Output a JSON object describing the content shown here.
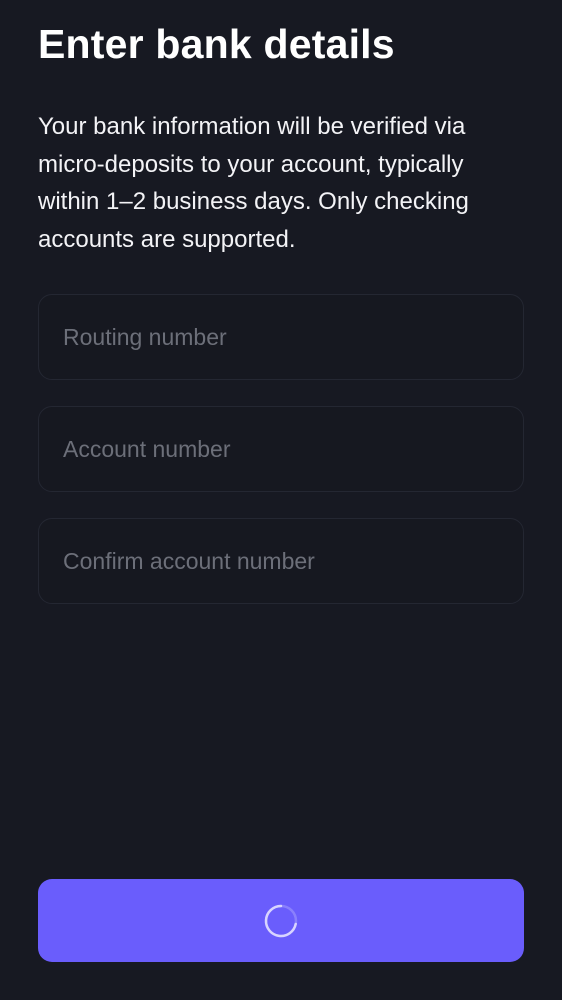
{
  "header": {
    "title": "Enter bank details"
  },
  "description": "Your bank information will be verified via micro-deposits to your account, typically within 1–2 business days. Only checking accounts are supported.",
  "form": {
    "routing_number": {
      "placeholder": "Routing number",
      "value": ""
    },
    "account_number": {
      "placeholder": "Account number",
      "value": ""
    },
    "confirm_account_number": {
      "placeholder": "Confirm account number",
      "value": ""
    }
  },
  "submit": {
    "state": "loading",
    "icon": "spinner-icon"
  },
  "colors": {
    "background": "#171922",
    "field_border": "#242732",
    "placeholder": "#6c6f79",
    "accent": "#6a5dfc",
    "text": "#ffffff"
  }
}
